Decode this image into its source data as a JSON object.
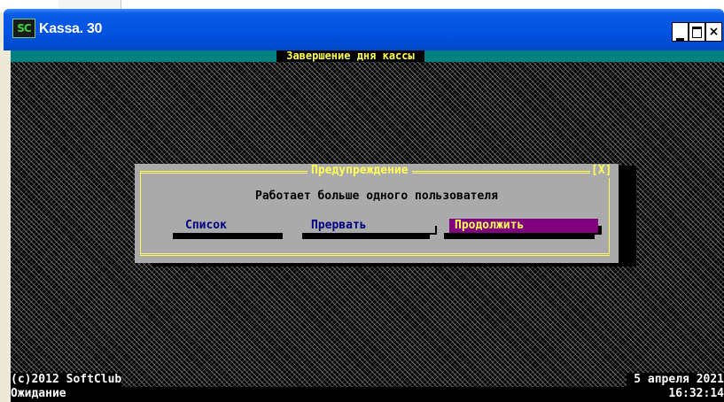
{
  "window": {
    "icon_text": "SC",
    "title": "Kassa. 30",
    "controls": {
      "minimize": "_",
      "maximize": "□",
      "close": "×"
    }
  },
  "screen": {
    "title": " Завершение дня кассы "
  },
  "dialog": {
    "title": " Предупреждение ",
    "close": "[X]",
    "message": "Работает больше одного пользователя",
    "buttons": [
      "Список",
      "Прервать",
      "Продолжить"
    ],
    "selected_index": 2
  },
  "statusbar": {
    "copyright": "(c)2012 SoftClub",
    "date": "5 апреля 2021",
    "state": "Ожидание",
    "time": "16:32:14"
  },
  "colors": {
    "title_bar": "#0052e0",
    "top_bar": "#008080",
    "dialog_bg": "#aaaaaa",
    "dialog_frame": "#ffff55",
    "selected_button": "#800080",
    "button_text": "#000080"
  }
}
